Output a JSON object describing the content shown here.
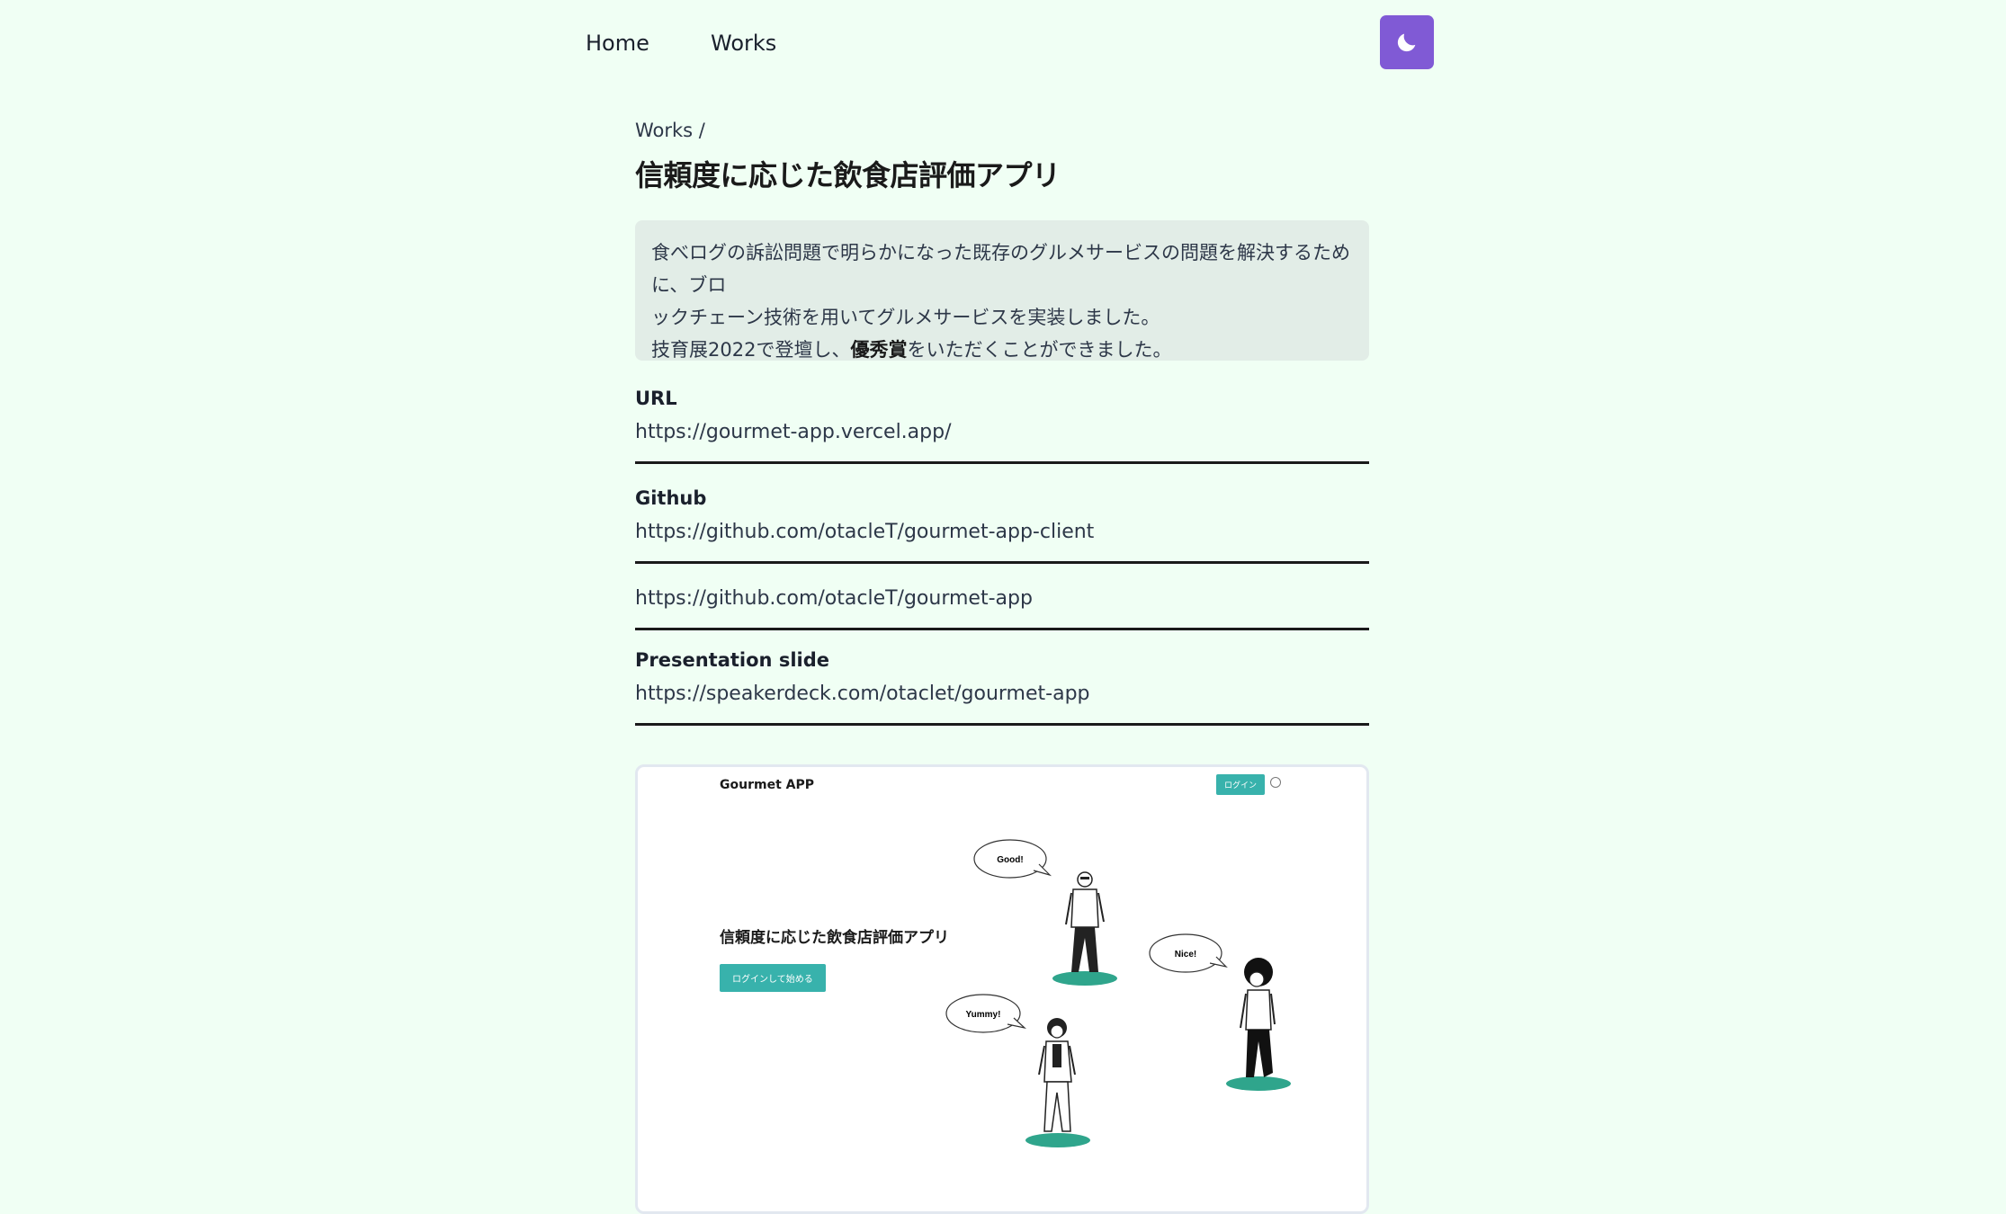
{
  "nav": {
    "home": "Home",
    "works": "Works",
    "theme_icon": "moon-icon",
    "theme_color": "#805ad5"
  },
  "breadcrumb": "Works /",
  "title": "信頼度に応じた飲食店評価アプリ",
  "description": {
    "line1": "食べログの訴訟問題で明らかになった既存のグルメサービスの問題を解決するために、ブロ",
    "line2": "ックチェーン技術を用いてグルメサービスを実装しました。",
    "line3_before": "技育展2022で登壇し、",
    "line3_bold": "優秀賞",
    "line3_after": "をいただくことができました。"
  },
  "links": {
    "url_label": "URL",
    "url": "https://gourmet-app.vercel.app/",
    "github_label": "Github",
    "github_1": "https://github.com/otacleT/gourmet-app-client",
    "github_2": "https://github.com/otacleT/gourmet-app",
    "slide_label": "Presentation slide",
    "slide": "https://speakerdeck.com/otaclet/gourmet-app"
  },
  "preview": {
    "brand": "Gourmet APP",
    "login": "ログイン",
    "user_icon": "user-circle-icon",
    "title": "信頼度に応じた飲食店評価アプリ",
    "start_button": "ログインして始める",
    "bubble_good": "Good!",
    "bubble_nice": "Nice!",
    "bubble_yummy": "Yummy!",
    "accent": "#38b2ac"
  },
  "colors": {
    "background": "#f0fff4",
    "description_bg": "#e2ede7"
  }
}
